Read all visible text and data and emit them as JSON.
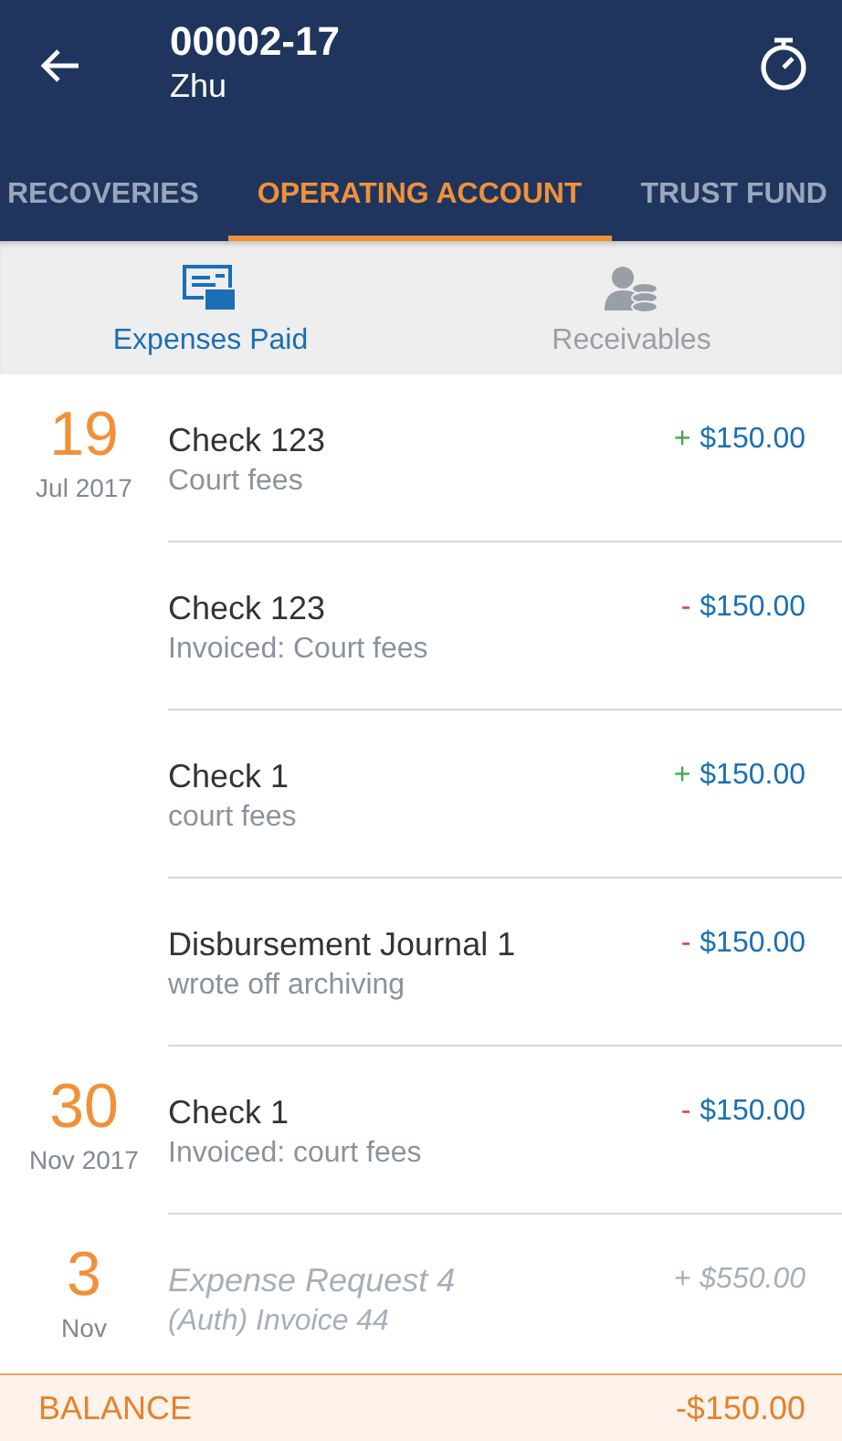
{
  "app_bar": {
    "title": "00002-17",
    "subtitle": "Zhu"
  },
  "tabs": [
    {
      "label": "RECOVERIES",
      "selected": false
    },
    {
      "label": "OPERATING ACCOUNT",
      "selected": true
    },
    {
      "label": "TRUST FUND",
      "selected": false
    }
  ],
  "sub_tabs": [
    {
      "label": "Expenses Paid",
      "kind": "card",
      "selected": true
    },
    {
      "label": "Receivables",
      "kind": "person-coins",
      "selected": false
    }
  ],
  "groups": [
    {
      "day": "19",
      "month": "Jul 2017",
      "entries": [
        {
          "title": "Check 123",
          "subtitle": "Court fees",
          "sign": "+",
          "kind": "credit",
          "amount": "$150.00",
          "pending": false
        },
        {
          "title": "Check 123",
          "subtitle": "Invoiced: Court fees",
          "sign": "-",
          "kind": "debit",
          "amount": "$150.00",
          "pending": false
        },
        {
          "title": "Check 1",
          "subtitle": "court fees",
          "sign": "+",
          "kind": "credit",
          "amount": "$150.00",
          "pending": false
        },
        {
          "title": "Disbursement Journal 1",
          "subtitle": "wrote off archiving",
          "sign": "-",
          "kind": "debit",
          "amount": "$150.00",
          "pending": false
        }
      ]
    },
    {
      "day": "30",
      "month": "Nov 2017",
      "entries": [
        {
          "title": "Check 1",
          "subtitle": "Invoiced: court fees",
          "sign": "-",
          "kind": "debit",
          "amount": "$150.00",
          "pending": false
        }
      ]
    },
    {
      "day": "3",
      "month": "Nov",
      "entries": [
        {
          "title": "Expense Request 4",
          "subtitle": "(Auth) Invoice 44",
          "sign": "+",
          "kind": "credit",
          "amount": "$550.00",
          "pending": true
        }
      ]
    }
  ],
  "balance": {
    "label": "BALANCE",
    "amount": "-$150.00"
  }
}
